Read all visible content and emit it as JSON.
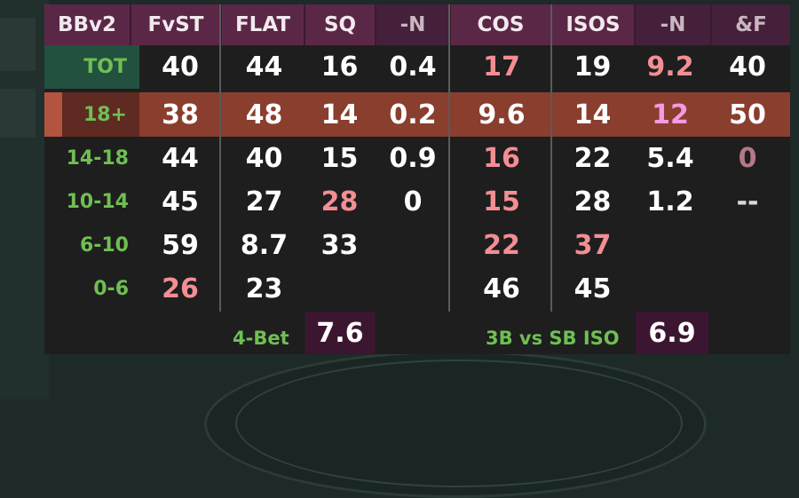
{
  "header": [
    "BBv2",
    "FvST",
    "FLAT",
    "SQ",
    "-N",
    "COS",
    "ISOS",
    "-N",
    "&F"
  ],
  "rows": [
    {
      "label": "TOT",
      "cells": [
        "40",
        "44",
        "16",
        "0.4",
        "17",
        "19",
        "9.2",
        "40"
      ]
    },
    {
      "label": "18+",
      "cells": [
        "38",
        "48",
        "14",
        "0.2",
        "9.6",
        "14",
        "12",
        "50"
      ]
    },
    {
      "label": "14-18",
      "cells": [
        "44",
        "40",
        "15",
        "0.9",
        "16",
        "22",
        "5.4",
        "0"
      ]
    },
    {
      "label": "10-14",
      "cells": [
        "45",
        "27",
        "28",
        "0",
        "15",
        "28",
        "1.2",
        "--"
      ]
    },
    {
      "label": "6-10",
      "cells": [
        "59",
        "8.7",
        "33",
        "",
        "22",
        "37",
        "",
        ""
      ]
    },
    {
      "label": "0-6",
      "cells": [
        "26",
        "23",
        "",
        "",
        "46",
        "45",
        "",
        ""
      ]
    }
  ],
  "footer": {
    "fourbet_label": "4-Bet",
    "fourbet_value": "7.6",
    "iso_label": "3B vs SB ISO",
    "iso_value": "6.9"
  },
  "colors": {
    "label_green": "#6fbf52",
    "pink_value": "#f38e93",
    "magenta_value": "#f49ae4",
    "row_18_bg": "#8a3e2e",
    "tot_label_bg": "#22513f",
    "header_bg": "#3a1b2c"
  }
}
